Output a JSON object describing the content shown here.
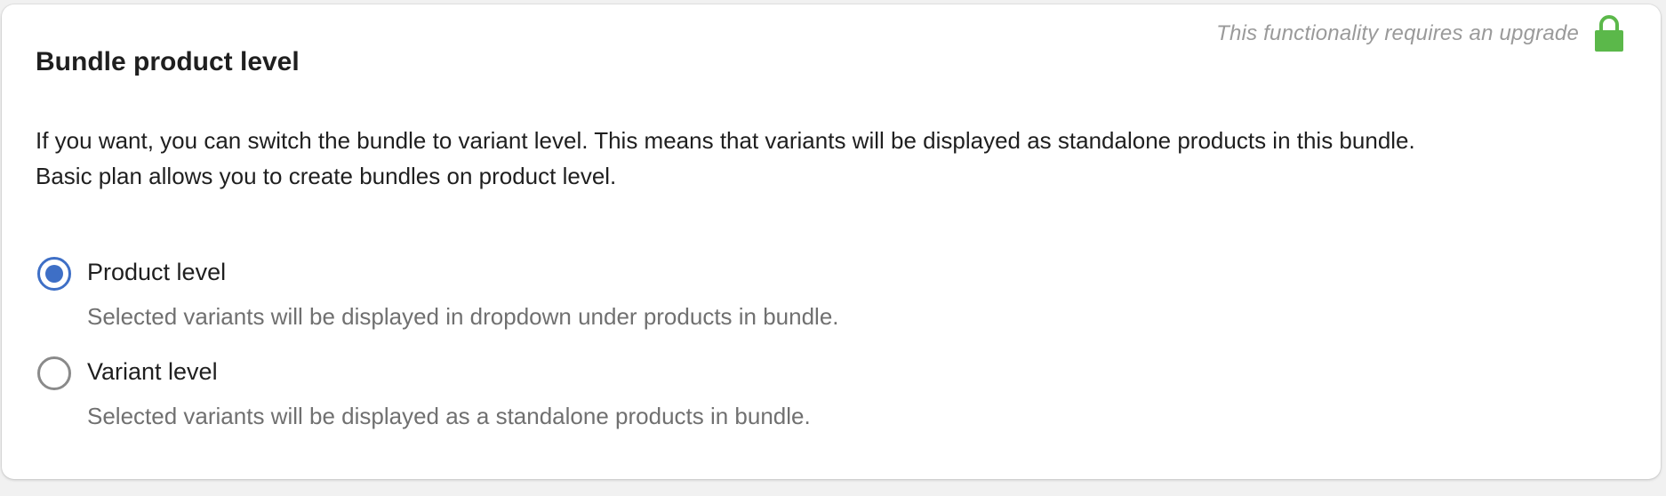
{
  "card": {
    "title": "Bundle product level",
    "description_line1": "If you want, you can switch the bundle to variant level. This means that variants will be displayed as standalone products in this bundle.",
    "description_line2": "Basic plan allows you to create bundles on product level.",
    "upgrade_note": "This functionality requires an upgrade",
    "upgrade_icon": "lock-icon",
    "colors": {
      "accent": "#3e6fc6",
      "lock": "#5bb84a"
    }
  },
  "options": [
    {
      "label": "Product level",
      "help": "Selected variants will be displayed in dropdown under products in bundle.",
      "selected": true
    },
    {
      "label": "Variant level",
      "help": "Selected variants will be displayed as a standalone products in bundle.",
      "selected": false
    }
  ]
}
